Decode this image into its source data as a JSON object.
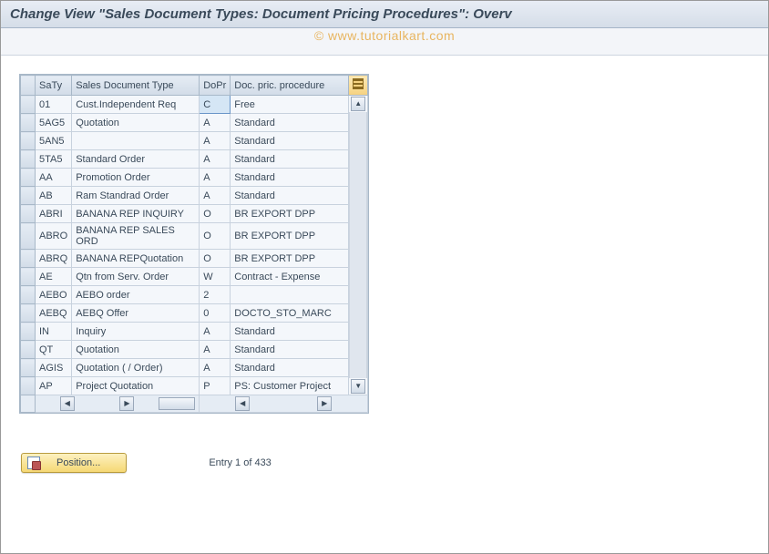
{
  "title": "Change View \"Sales Document Types: Document Pricing Procedures\": Overv",
  "watermark": "© www.tutorialkart.com",
  "columns": {
    "saty": "SaTy",
    "sdt": "Sales Document Type",
    "dopr": "DoPr",
    "dpp": "Doc. pric. procedure"
  },
  "rows": [
    {
      "saty": "01",
      "sdt": "Cust.Independent Req",
      "dopr": "C",
      "dpp": "Free",
      "hl": true
    },
    {
      "saty": "5AG5",
      "sdt": "Quotation",
      "dopr": "A",
      "dpp": "Standard"
    },
    {
      "saty": "5AN5",
      "sdt": "",
      "dopr": "A",
      "dpp": "Standard"
    },
    {
      "saty": "5TA5",
      "sdt": "Standard Order",
      "dopr": "A",
      "dpp": "Standard"
    },
    {
      "saty": "AA",
      "sdt": "Promotion Order",
      "dopr": "A",
      "dpp": "Standard"
    },
    {
      "saty": "AB",
      "sdt": "Ram Standrad Order",
      "dopr": "A",
      "dpp": "Standard"
    },
    {
      "saty": "ABRI",
      "sdt": "BANANA REP INQUIRY",
      "dopr": "O",
      "dpp": "BR EXPORT DPP"
    },
    {
      "saty": "ABRO",
      "sdt": "BANANA REP SALES ORD",
      "dopr": "O",
      "dpp": "BR EXPORT DPP"
    },
    {
      "saty": "ABRQ",
      "sdt": "BANANA REPQuotation",
      "dopr": "O",
      "dpp": "BR EXPORT DPP"
    },
    {
      "saty": "AE",
      "sdt": "Qtn from Serv. Order",
      "dopr": "W",
      "dpp": "Contract - Expense"
    },
    {
      "saty": "AEBO",
      "sdt": "AEBO order",
      "dopr": "2",
      "dpp": ""
    },
    {
      "saty": "AEBQ",
      "sdt": "AEBQ Offer",
      "dopr": "0",
      "dpp": "DOCTO_STO_MARC"
    },
    {
      "saty": "IN",
      "sdt": "Inquiry",
      "dopr": "A",
      "dpp": "Standard"
    },
    {
      "saty": "QT",
      "sdt": "Quotation",
      "dopr": "A",
      "dpp": "Standard"
    },
    {
      "saty": "AGIS",
      "sdt": "Quotation ( / Order)",
      "dopr": "A",
      "dpp": "Standard"
    },
    {
      "saty": "AP",
      "sdt": "Project Quotation",
      "dopr": "P",
      "dpp": "PS: Customer Project"
    }
  ],
  "footer": {
    "position_label": "Position...",
    "entry_text": "Entry 1 of 433"
  },
  "scroll_glyphs": {
    "up": "▲",
    "down": "▼",
    "left": "◀",
    "right": "▶"
  }
}
